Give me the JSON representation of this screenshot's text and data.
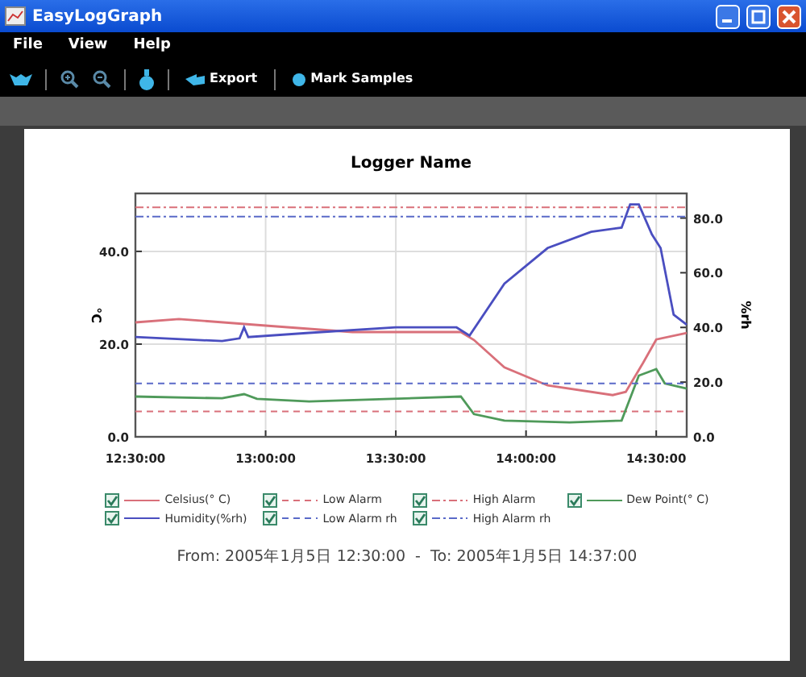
{
  "window": {
    "title": "EasyLogGraph"
  },
  "menu": [
    "File",
    "View",
    "Help"
  ],
  "toolbar": [
    {
      "kind": "icon"
    },
    {
      "kind": "separator"
    },
    {
      "kind": "icon"
    },
    {
      "kind": "icon"
    },
    {
      "kind": "separator"
    },
    {
      "kind": "icon"
    },
    {
      "kind": "separator"
    },
    {
      "kind": "button",
      "label": "Export"
    },
    {
      "kind": "separator"
    },
    {
      "kind": "button",
      "label": "Mark Samples"
    }
  ],
  "chart": {
    "chart_data": {
      "type": "line",
      "title": "Logger Name",
      "ylabel": "°C",
      "y2label": "%rh",
      "grid": true,
      "xlim": [
        12.5,
        14.617
      ],
      "ylim": [
        0,
        52.5
      ],
      "y2lim": [
        0,
        89
      ],
      "xticks": [
        {
          "value": 12.5,
          "label": "12:30:00"
        },
        {
          "value": 13,
          "label": "13:00:00"
        },
        {
          "value": 13.5,
          "label": "13:30:00"
        },
        {
          "value": 14,
          "label": "14:00:00"
        },
        {
          "value": 14.5,
          "label": "14:30:00"
        }
      ],
      "yticks": [
        {
          "value": 0,
          "label": "0.0"
        },
        {
          "value": 20,
          "label": "20.0"
        },
        {
          "value": 40,
          "label": "40.0"
        }
      ],
      "y2ticks": [
        {
          "value": 0,
          "label": "0.0"
        },
        {
          "value": 20,
          "label": "20.0"
        },
        {
          "value": 40,
          "label": "40.0"
        },
        {
          "value": 60,
          "label": "60.0"
        },
        {
          "value": 80,
          "label": "80.0"
        }
      ],
      "series": [
        {
          "name": "Celsius(° C)",
          "color": "#d9707a",
          "x": [
            12.5,
            12.667,
            13,
            13.333,
            13.75,
            13.8,
            13.917,
            14.083,
            14.333,
            14.383,
            14.45,
            14.5,
            14.617
          ],
          "values": [
            24.7,
            25.4,
            24,
            22.6,
            22.6,
            20.9,
            15,
            11.1,
            9,
            9.7,
            16,
            21,
            22.4
          ]
        },
        {
          "name": "Low Alarm",
          "color": "#d9707a",
          "line_style": "dashed",
          "x": [
            12.5,
            14.617
          ],
          "values": [
            5.5,
            5.5
          ]
        },
        {
          "name": "High Alarm",
          "color": "#d9707a",
          "line_style": "dashdot",
          "x": [
            12.5,
            14.617
          ],
          "values": [
            49.5,
            49.5
          ]
        },
        {
          "name": "Dew Point(° C)",
          "color": "#4f9a5a",
          "x": [
            12.5,
            12.833,
            12.917,
            12.967,
            13.167,
            13.75,
            13.8,
            13.917,
            14.167,
            14.367,
            14.433,
            14.5,
            14.533,
            14.617
          ],
          "values": [
            8.7,
            8.3,
            9.2,
            8.2,
            7.6,
            8.7,
            4.9,
            3.5,
            3.1,
            3.5,
            13.2,
            14.6,
            11.5,
            10.4
          ]
        },
        {
          "name": "Humidity(%rh)",
          "color": "#4a4ec0",
          "axis": "y2",
          "x": [
            12.5,
            12.833,
            12.9,
            12.917,
            12.933,
            13.167,
            13.5,
            13.733,
            13.783,
            13.917,
            14.083,
            14.25,
            14.367,
            14.4,
            14.433,
            14.483,
            14.517,
            14.567,
            14.617
          ],
          "values": [
            36.5,
            35,
            36,
            40,
            36.5,
            38,
            40,
            40,
            37,
            56,
            69,
            75,
            76.5,
            85,
            85,
            74,
            69,
            44.7,
            41
          ]
        },
        {
          "name": "Low Alarm rh",
          "color": "#5a6ac8",
          "line_style": "dashed",
          "axis": "y2",
          "x": [
            12.5,
            14.617
          ],
          "values": [
            19.5,
            19.5
          ]
        },
        {
          "name": "High Alarm rh",
          "color": "#5a6ac8",
          "line_style": "dashdot",
          "axis": "y2",
          "x": [
            12.5,
            14.617
          ],
          "values": [
            80.5,
            80.5
          ]
        }
      ]
    },
    "legend": [
      {
        "checked": true
      },
      {
        "checked": true
      },
      {
        "checked": true
      },
      {
        "checked": true
      },
      {
        "checked": true
      },
      {
        "checked": true
      },
      {
        "checked": true
      }
    ],
    "range_caption": "From: 2005年1月5日 12:30:00  -  To: 2005年1月5日 14:37:00"
  }
}
